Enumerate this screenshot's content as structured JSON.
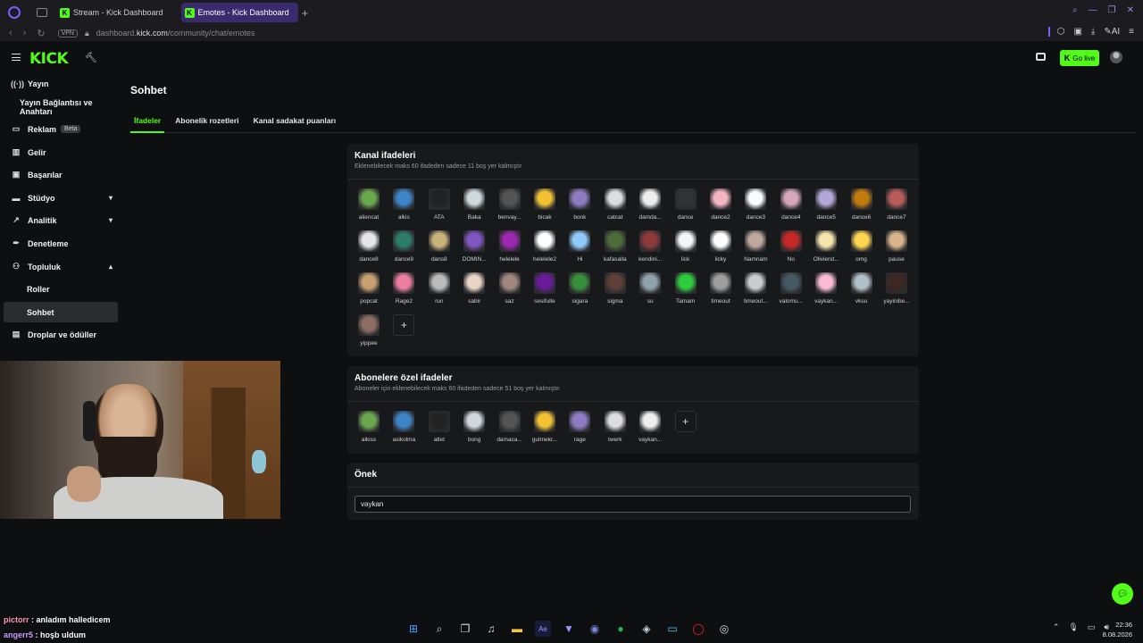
{
  "browser": {
    "tabs": [
      {
        "label": "Stream - Kick Dashboard",
        "active": false
      },
      {
        "label": "Emotes - Kick Dashboard",
        "active": true
      }
    ],
    "vpn_label": "VPN",
    "url_prefix": "dashboard.",
    "url_host": "kick.com",
    "url_path": "/community/chat/emotes",
    "ai_label": "AI"
  },
  "header": {
    "logo": "KICK",
    "go_live": "Go live"
  },
  "sidebar": {
    "items": [
      {
        "label": "Yayın",
        "icon": "broadcast-icon"
      },
      {
        "label": "Yayın Bağlantısı ve Anahtarı",
        "icon": ""
      },
      {
        "label": "Reklam",
        "icon": "ad-icon",
        "badge": "Beta"
      },
      {
        "label": "Gelir",
        "icon": "revenue-icon"
      },
      {
        "label": "Başarılar",
        "icon": "trophy-icon"
      },
      {
        "label": "Stüdyo",
        "icon": "studio-icon"
      },
      {
        "label": "Analitik",
        "icon": "analytics-icon"
      },
      {
        "label": "Denetleme",
        "icon": "moderation-icon"
      },
      {
        "label": "Topluluk",
        "icon": "community-icon"
      },
      {
        "label": "Roller",
        "icon": ""
      },
      {
        "label": "Sohbet",
        "icon": ""
      },
      {
        "label": "Droplar ve ödüller",
        "icon": "drops-icon"
      }
    ]
  },
  "main": {
    "title": "Sohbet",
    "tabs": [
      "İfadeler",
      "Abonelik rozetleri",
      "Kanal sadakat puanları"
    ]
  },
  "channel_emotes": {
    "title": "Kanal ifadeleri",
    "subtitle": "Eklenebilecek maks 60 ifadeden sadece 11 boş yer kalmıştır",
    "items": [
      "aliencat",
      "alkis",
      "ATA",
      "Baka",
      "benvay...",
      "bicak",
      "bonk",
      "catcat",
      "damda...",
      "dance",
      "dance2",
      "dance3",
      "dance4",
      "dance5",
      "dance6",
      "dance7",
      "dance8",
      "dance9",
      "dans8",
      "DOMIN...",
      "helelele",
      "helelele2",
      "Hi",
      "kafasalla",
      "kendini...",
      "lick",
      "licky",
      "Namnam",
      "No",
      "Olivierst...",
      "omg",
      "pause",
      "popcat",
      "Rage2",
      "run",
      "sabir",
      "saz",
      "sesifulle",
      "sigara",
      "sigma",
      "su",
      "Tamam",
      "timeout",
      "timeout...",
      "valomu...",
      "vaykan...",
      "vksu",
      "yayinibe...",
      "yippee"
    ]
  },
  "sub_emotes": {
    "title": "Abonelere özel ifadeler",
    "subtitle": "Aboneler için eklenebilecek maks 60 ifadeden sadece 51 boş yer kalmıştır",
    "items": [
      "alkiss",
      "asikolma",
      "atlet",
      "bong",
      "damaca...",
      "gulmekr...",
      "rage",
      "twerk",
      "vaykan..."
    ]
  },
  "prefix": {
    "title": "Önek",
    "value": "vaykan"
  },
  "chat_overlay": [
    {
      "user": "pictorr",
      "text": " : anladım halledicem"
    },
    {
      "user": "angerr5",
      "text": " : hoşb uldum"
    }
  ],
  "clock": {
    "time": "22:36",
    "date": "8.08.2026"
  },
  "colors": {
    "accent": "#53fc18",
    "bg": "#0e0f10",
    "card": "#18191b"
  }
}
